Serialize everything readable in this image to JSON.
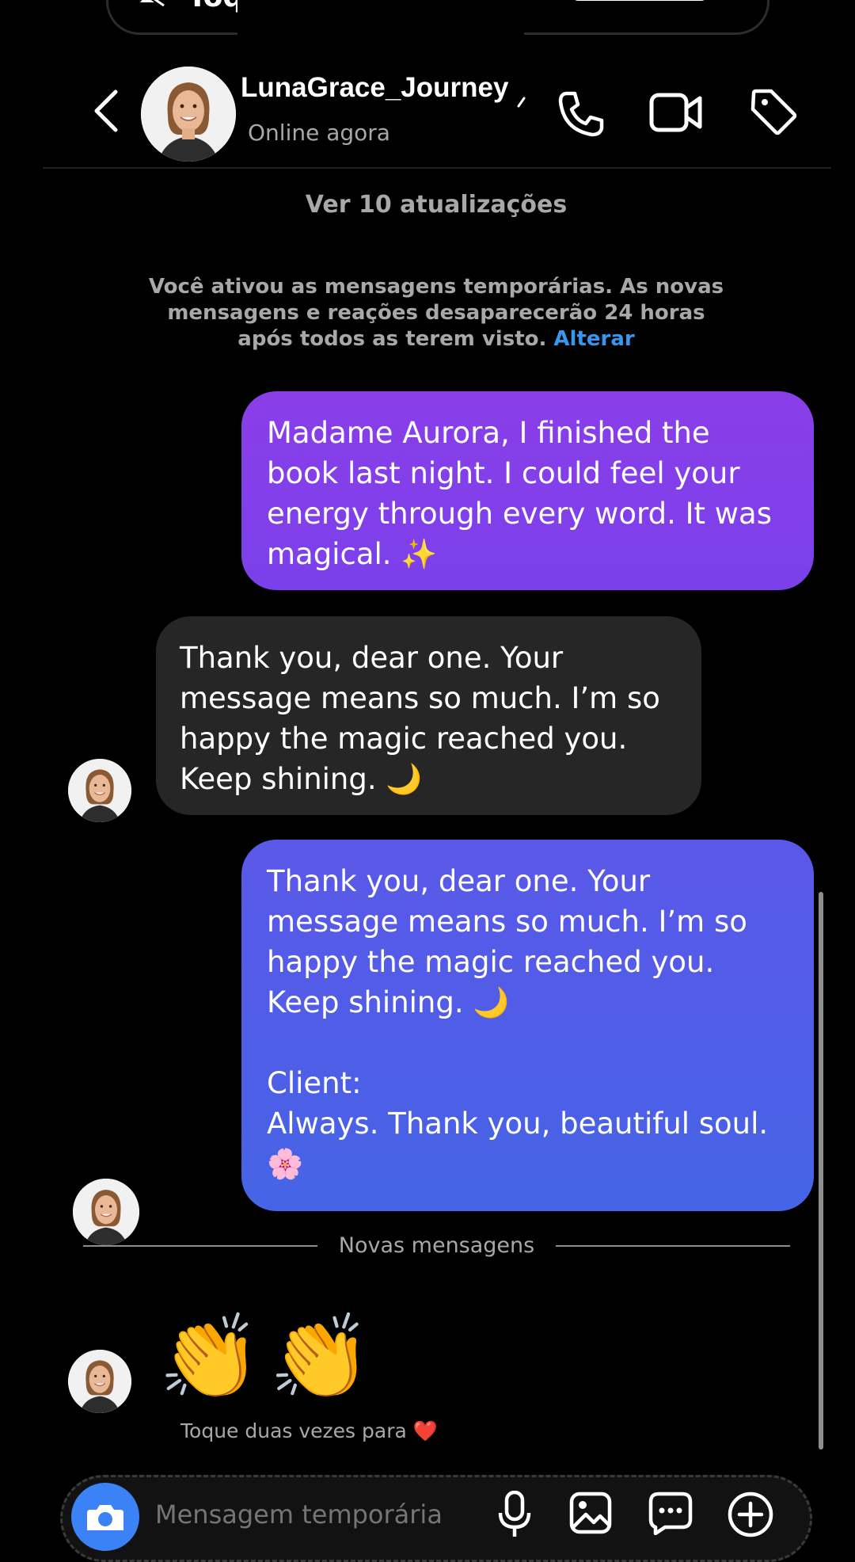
{
  "top_banner": {
    "label": "Toque"
  },
  "header": {
    "username": "LunaGrace_Journey",
    "status": "Online agora",
    "icons": [
      "back-arrow-icon",
      "phone-icon",
      "video-camera-icon",
      "tag-icon"
    ]
  },
  "updates_link": "Ver 10 atualizações",
  "notice": {
    "text": "Você ativou as mensagens temporárias. As novas mensagens e reações desaparecerão 24 horas após todos as terem visto.",
    "link": "Alterar"
  },
  "messages": [
    {
      "sender": "me",
      "text": "Madame Aurora, I finished the\nbook last night. I could feel your\nenergy through every word. It was\nmagical. ✨"
    },
    {
      "sender": "them",
      "text": "Thank you, dear one. Your\nmessage means so much. I’m so\nhappy the magic reached you.\nKeep shining. 🌙"
    },
    {
      "sender": "me",
      "text": "Thank you, dear one. Your\nmessage means so much. I’m so\nhappy the magic reached you.\nKeep  shining. 🌙\n\nClient:\nAlways. Thank you, beautiful soul.\n🌸"
    }
  ],
  "new_messages_label": "Novas mensagens",
  "reaction": {
    "emoji": "👏👏",
    "hint": "Toque duas vezes para ❤️"
  },
  "composer": {
    "placeholder": "Mensagem temporária",
    "icons": [
      "camera-icon",
      "microphone-icon",
      "gallery-icon",
      "sticker-icon",
      "plus-icon"
    ]
  },
  "colors": {
    "accent_link": "#3797f0",
    "bubble_sent_top": "#8a3ee8",
    "bubble_sent_bottom": "#4565e6",
    "bubble_received": "#262626",
    "background": "#000000"
  }
}
